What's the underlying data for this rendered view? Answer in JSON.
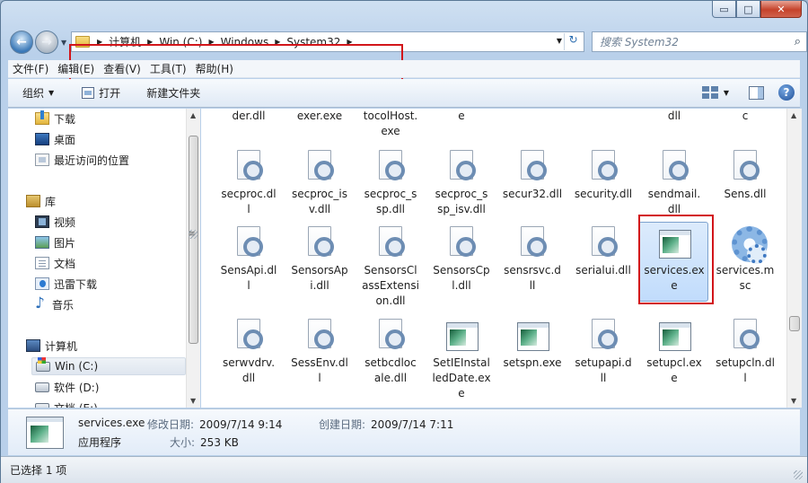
{
  "window": {
    "controls": {
      "minimize": "▭",
      "maximize": "□",
      "close": "✕"
    }
  },
  "address": {
    "crumbs": [
      "计算机",
      "Win (C:)",
      "Windows",
      "System32"
    ]
  },
  "search": {
    "placeholder": "搜索 System32"
  },
  "menu": [
    "文件(F)",
    "编辑(E)",
    "查看(V)",
    "工具(T)",
    "帮助(H)"
  ],
  "toolbar": {
    "organize": "组织",
    "open": "打开",
    "new_folder": "新建文件夹"
  },
  "nav": {
    "items": [
      {
        "label": "下载",
        "icon": "download-folder-icon"
      },
      {
        "label": "桌面",
        "icon": "desktop-icon"
      },
      {
        "label": "最近访问的位置",
        "icon": "recent-places-icon"
      },
      {
        "label": "库",
        "icon": "library-icon"
      },
      {
        "label": "视频",
        "icon": "video-library-icon"
      },
      {
        "label": "图片",
        "icon": "picture-library-icon"
      },
      {
        "label": "文档",
        "icon": "document-library-icon"
      },
      {
        "label": "迅雷下载",
        "icon": "xunlei-download-icon"
      },
      {
        "label": "音乐",
        "icon": "music-library-icon"
      },
      {
        "label": "计算机",
        "icon": "computer-icon"
      },
      {
        "label": "Win (C:)",
        "icon": "system-drive-icon"
      },
      {
        "label": "软件 (D:)",
        "icon": "drive-icon"
      },
      {
        "label": "文档 (E:)",
        "icon": "drive-icon"
      }
    ]
  },
  "files": {
    "row0": [
      "der.dll",
      "exer.exe",
      "tocolHost.\nexe",
      "e",
      "",
      "",
      "dll",
      "c"
    ],
    "row1": [
      {
        "name": "secproc.dl\nl",
        "type": "dll"
      },
      {
        "name": "secproc_is\nv.dll",
        "type": "dll"
      },
      {
        "name": "secproc_s\nsp.dll",
        "type": "dll"
      },
      {
        "name": "secproc_s\nsp_isv.dll",
        "type": "dll"
      },
      {
        "name": "secur32.dll",
        "type": "dll"
      },
      {
        "name": "security.dll",
        "type": "dll"
      },
      {
        "name": "sendmail.\ndll",
        "type": "dll"
      },
      {
        "name": "Sens.dll",
        "type": "dll"
      }
    ],
    "row2": [
      {
        "name": "SensApi.dl\nl",
        "type": "dll"
      },
      {
        "name": "SensorsAp\ni.dll",
        "type": "dll"
      },
      {
        "name": "SensorsCl\nassExtensi\non.dll",
        "type": "dll"
      },
      {
        "name": "SensorsCp\nl.dll",
        "type": "dll"
      },
      {
        "name": "sensrsvc.d\nll",
        "type": "dll"
      },
      {
        "name": "serialui.dll",
        "type": "dll"
      },
      {
        "name": "services.ex\ne",
        "type": "exe"
      },
      {
        "name": "services.m\nsc",
        "type": "msc"
      }
    ],
    "row3": [
      {
        "name": "serwvdrv.\ndll",
        "type": "dll"
      },
      {
        "name": "SessEnv.dl\nl",
        "type": "dll"
      },
      {
        "name": "setbcdloc\nale.dll",
        "type": "dll"
      },
      {
        "name": "SetIEInstal\nledDate.ex\ne",
        "type": "exe"
      },
      {
        "name": "setspn.exe",
        "type": "exe"
      },
      {
        "name": "setupapi.d\nll",
        "type": "dll"
      },
      {
        "name": "setupcl.ex\ne",
        "type": "exe"
      },
      {
        "name": "setupcln.dl\nl",
        "type": "dll"
      }
    ]
  },
  "details": {
    "name": "services.exe",
    "type": "应用程序",
    "modified_label": "修改日期:",
    "modified": "2009/7/14 9:14",
    "created_label": "创建日期:",
    "created": "2009/7/14 7:11",
    "size_label": "大小:",
    "size": "253 KB"
  },
  "status": {
    "selection": "已选择 1 项"
  },
  "colors": {
    "accent_red": "#d2151a",
    "selection": "#c1dcfc"
  }
}
